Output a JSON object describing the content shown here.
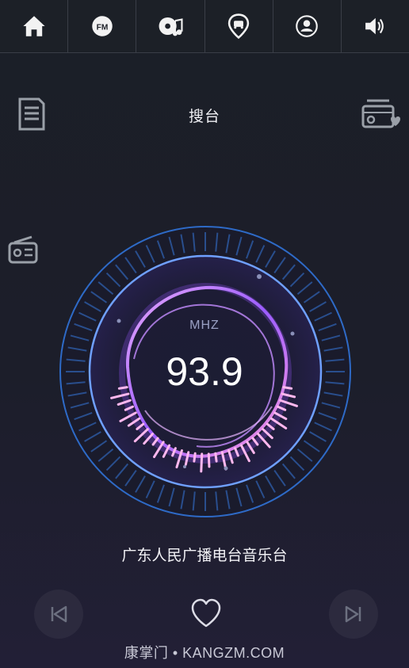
{
  "nav": {
    "tabs": [
      {
        "name": "home",
        "icon": "home-icon"
      },
      {
        "name": "fm",
        "icon": "fm-icon",
        "label": "FM"
      },
      {
        "name": "music",
        "icon": "music-disc-icon"
      },
      {
        "name": "navigation",
        "icon": "car-location-icon"
      },
      {
        "name": "profile",
        "icon": "user-icon"
      },
      {
        "name": "volume",
        "icon": "volume-icon"
      }
    ]
  },
  "header": {
    "title": "搜台",
    "left_icon": "document-list-icon",
    "right_icon": "radio-favorite-icon",
    "secondary_left_icon": "radio-icon"
  },
  "tuner": {
    "unit": "MHZ",
    "frequency": "93.9"
  },
  "station": {
    "name": "广东人民广播电台音乐台"
  },
  "controls": {
    "prev_icon": "skip-previous-icon",
    "favorite_icon": "heart-icon",
    "next_icon": "skip-next-icon"
  },
  "watermark": "康掌门 • KANGZM.COM",
  "colors": {
    "background": "#1b1f27",
    "accent_purple": "#b57bff",
    "accent_pink": "#ff9be0",
    "ring_blue": "#2f6fd0"
  }
}
